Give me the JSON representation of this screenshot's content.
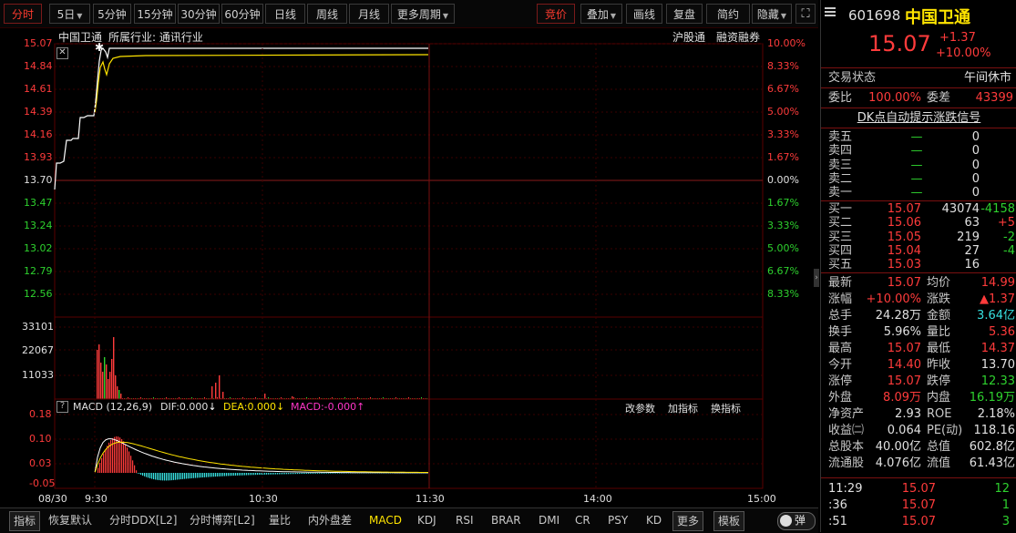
{
  "toolbar": {
    "tabs": [
      {
        "label": "分时",
        "active": true
      },
      {
        "label": "5日",
        "dropdown": true
      },
      {
        "label": "5分钟"
      },
      {
        "label": "15分钟"
      },
      {
        "label": "30分钟"
      },
      {
        "label": "60分钟"
      },
      {
        "label": "日线"
      },
      {
        "label": "周线"
      },
      {
        "label": "月线"
      },
      {
        "label": "更多周期",
        "dropdown": true
      }
    ],
    "right": [
      {
        "label": "竞价",
        "active": true
      },
      {
        "label": "叠加",
        "dropdown": true
      },
      {
        "label": "画线"
      },
      {
        "label": "复盘"
      },
      {
        "label": "简约"
      },
      {
        "label": "隐藏",
        "dropdown": true
      }
    ],
    "fullscreen_icon": "expand-icon"
  },
  "price_chart": {
    "stock_name": "中国卫通",
    "industry": "所属行业: 通讯行业",
    "links": [
      "沪股通",
      "融资融券"
    ],
    "close_icon": "close-icon",
    "y_prices": [
      {
        "v": "15.07",
        "c": "red"
      },
      {
        "v": "14.84",
        "c": "red"
      },
      {
        "v": "14.61",
        "c": "red"
      },
      {
        "v": "14.39",
        "c": "red"
      },
      {
        "v": "14.16",
        "c": "red"
      },
      {
        "v": "13.93",
        "c": "red"
      },
      {
        "v": "13.70",
        "c": "white"
      },
      {
        "v": "13.47",
        "c": "green"
      },
      {
        "v": "13.24",
        "c": "green"
      },
      {
        "v": "13.02",
        "c": "green"
      },
      {
        "v": "12.79",
        "c": "green"
      },
      {
        "v": "12.56",
        "c": "green"
      }
    ],
    "y_pcts": [
      {
        "v": "10.00%",
        "c": "red"
      },
      {
        "v": "8.33%",
        "c": "red"
      },
      {
        "v": "6.67%",
        "c": "red"
      },
      {
        "v": "5.00%",
        "c": "red"
      },
      {
        "v": "3.33%",
        "c": "red"
      },
      {
        "v": "1.67%",
        "c": "red"
      },
      {
        "v": "0.00%",
        "c": "white"
      },
      {
        "v": "1.67%",
        "c": "green"
      },
      {
        "v": "3.33%",
        "c": "green"
      },
      {
        "v": "5.00%",
        "c": "green"
      },
      {
        "v": "6.67%",
        "c": "green"
      },
      {
        "v": "8.33%",
        "c": "green"
      }
    ]
  },
  "volume_chart": {
    "y_labels": [
      "33101",
      "22067",
      "11033"
    ]
  },
  "macd_panel": {
    "help_icon": "question-icon",
    "title": "MACD (12,26,9)",
    "dif": "DIF:0.000",
    "dea": "DEA:0.000",
    "macd": "MACD:-0.000",
    "actions": [
      "改参数",
      "加指标",
      "换指标"
    ],
    "y_labels": [
      "0.18",
      "0.10",
      "0.03",
      "-0.05"
    ]
  },
  "time_axis": [
    "08/30",
    "9:30",
    "10:30",
    "11:30",
    "14:00",
    "15:00"
  ],
  "bottom_bar": {
    "items": [
      {
        "label": "指标",
        "box": true
      },
      {
        "label": "恢复默认"
      },
      {
        "label": "分时DDX[L2]"
      },
      {
        "label": "分时博弈[L2]"
      },
      {
        "label": "量比"
      },
      {
        "label": "内外盘差"
      },
      {
        "label": "MACD",
        "active": true
      },
      {
        "label": "KDJ"
      },
      {
        "label": "RSI"
      },
      {
        "label": "BRAR"
      },
      {
        "label": "DMI"
      },
      {
        "label": "CR"
      },
      {
        "label": "PSY"
      },
      {
        "label": "KD"
      },
      {
        "label": "更多",
        "box": true
      },
      {
        "label": "模板",
        "box": true
      }
    ],
    "toggle_label": "弹"
  },
  "quote": {
    "code": "601698",
    "name": "中国卫通",
    "price": "15.07",
    "change": "+1.37",
    "change_pct": "+10.00%",
    "status_label": "交易状态",
    "status_value": "午间休市",
    "weibi_label": "委比",
    "weibi_value": "100.00%",
    "weicha_label": "委差",
    "weicha_value": "43399",
    "signal": "DK点自动提示涨跌信号",
    "sells": [
      {
        "label": "卖五",
        "price": "—",
        "vol": "0"
      },
      {
        "label": "卖四",
        "price": "—",
        "vol": "0"
      },
      {
        "label": "卖三",
        "price": "—",
        "vol": "0"
      },
      {
        "label": "卖二",
        "price": "—",
        "vol": "0"
      },
      {
        "label": "卖一",
        "price": "—",
        "vol": "0"
      }
    ],
    "buys": [
      {
        "label": "买一",
        "price": "15.07",
        "vol": "43074",
        "chg": "-4158",
        "cc": "green"
      },
      {
        "label": "买二",
        "price": "15.06",
        "vol": "63",
        "chg": "+5",
        "cc": "red"
      },
      {
        "label": "买三",
        "price": "15.05",
        "vol": "219",
        "chg": "-2",
        "cc": "green"
      },
      {
        "label": "买四",
        "price": "15.04",
        "vol": "27",
        "chg": "-4",
        "cc": "green"
      },
      {
        "label": "买五",
        "price": "15.03",
        "vol": "16",
        "chg": "",
        "cc": "white"
      }
    ],
    "stats": [
      {
        "l1": "最新",
        "v1": "15.07",
        "c1": "red",
        "l2": "均价",
        "v2": "14.99",
        "c2": "red"
      },
      {
        "l1": "涨幅",
        "v1": "+10.00%",
        "c1": "red",
        "l2": "涨跌",
        "v2": "▲1.37",
        "c2": "red"
      },
      {
        "l1": "总手",
        "v1": "24.28万",
        "c1": "white",
        "l2": "金额",
        "v2": "3.64亿",
        "c2": "cyan"
      },
      {
        "l1": "换手",
        "v1": "5.96%",
        "c1": "white",
        "l2": "量比",
        "v2": "5.36",
        "c2": "red"
      },
      {
        "l1": "最高",
        "v1": "15.07",
        "c1": "red",
        "l2": "最低",
        "v2": "14.37",
        "c2": "red"
      },
      {
        "l1": "今开",
        "v1": "14.40",
        "c1": "red",
        "l2": "昨收",
        "v2": "13.70",
        "c2": "white"
      },
      {
        "l1": "涨停",
        "v1": "15.07",
        "c1": "red",
        "l2": "跌停",
        "v2": "12.33",
        "c2": "green"
      },
      {
        "l1": "外盘",
        "v1": "8.09万",
        "c1": "red",
        "l2": "内盘",
        "v2": "16.19万",
        "c2": "green"
      },
      {
        "l1": "净资产",
        "v1": "2.93",
        "c1": "white",
        "l2": "ROE",
        "v2": "2.18%",
        "c2": "white"
      },
      {
        "l1": "收益㈡",
        "v1": "0.064",
        "c1": "white",
        "l2": "PE(动)",
        "v2": "118.16",
        "c2": "white"
      },
      {
        "l1": "总股本",
        "v1": "40.00亿",
        "c1": "white",
        "l2": "总值",
        "v2": "602.8亿",
        "c2": "white"
      },
      {
        "l1": "流通股",
        "v1": "4.076亿",
        "c1": "white",
        "l2": "流值",
        "v2": "61.43亿",
        "c2": "white"
      }
    ],
    "ticks": [
      {
        "time": "11:29",
        "price": "15.07",
        "vol": "12",
        "vc": "green"
      },
      {
        "time": ":36",
        "price": "15.07",
        "vol": "1",
        "vc": "green"
      },
      {
        "time": ":51",
        "price": "15.07",
        "vol": "3",
        "vc": "green"
      }
    ]
  },
  "colors": {
    "red": "#ff3b3b",
    "green": "#2ed12e",
    "yellow": "#ffe400",
    "grid": "#5a0000"
  }
}
